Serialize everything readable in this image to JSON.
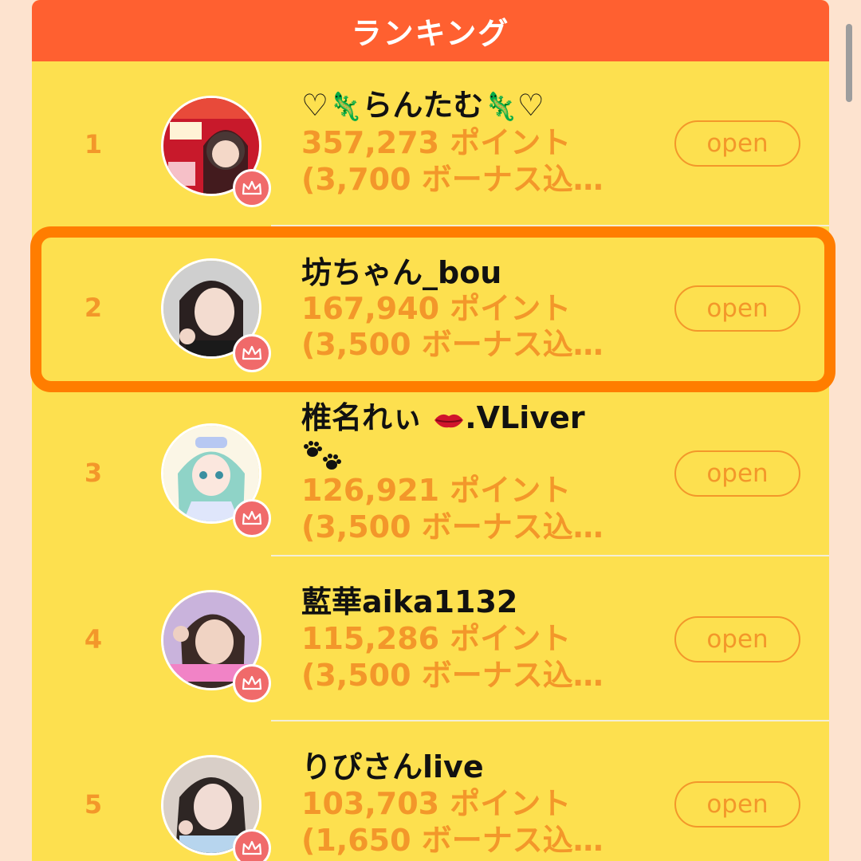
{
  "header": {
    "title": "ランキング"
  },
  "open_label": "open",
  "colors": {
    "header_bg": "#ff6030",
    "panel_bg": "#fde04f",
    "accent_orange": "#f3972a",
    "highlight_frame": "#ff7d00",
    "crown_badge": "#f06a6a"
  },
  "rows": [
    {
      "rank": "1",
      "name": "らんたむ",
      "name_prefix": "♡",
      "name_suffix": "♡",
      "name_decor_icon": "lizard-icon",
      "points": "357,273 ポイント",
      "bonus": "(3,700 ボーナス込…"
    },
    {
      "rank": "2",
      "name": "坊ちゃん_bou",
      "points": "167,940 ポイント",
      "bonus": "(3,500 ボーナス込…",
      "highlighted": true
    },
    {
      "rank": "3",
      "name": "椎名れぃ",
      "name_suffix": ".VLiver",
      "name_decor_icon": "lips-icon",
      "name_second_line_icon": "paw-prints-icon",
      "points": "126,921 ポイント",
      "bonus": "(3,500 ボーナス込…"
    },
    {
      "rank": "4",
      "name": "藍華aika1132",
      "points": "115,286 ポイント",
      "bonus": "(3,500 ボーナス込…"
    },
    {
      "rank": "5",
      "name": "りぴさんlive",
      "points": "103,703 ポイント",
      "bonus": "(1,650 ボーナス込…"
    }
  ]
}
